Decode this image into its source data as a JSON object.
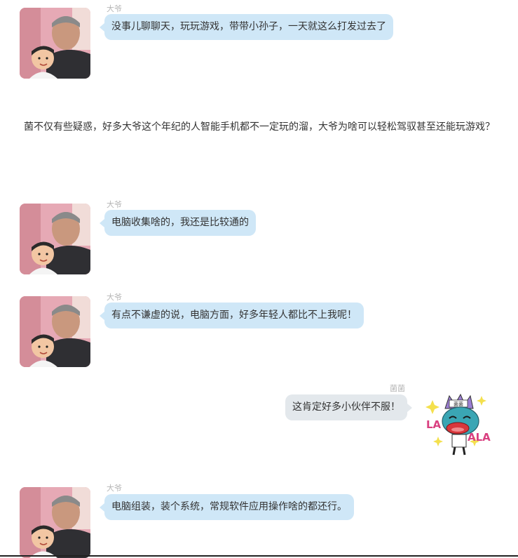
{
  "messages": [
    {
      "speaker": "大爷",
      "text": "没事儿聊聊天，玩玩游戏，带带小孙子，一天就这么打发过去了"
    },
    {
      "speaker": "大爷",
      "text": "电脑收集啥的，我还是比较通的"
    },
    {
      "speaker": "大爷",
      "text": "有点不谦虚的说，电脑方面，好多年轻人都比不上我呢！"
    },
    {
      "speaker": "菌菌",
      "text": "这肯定好多小伙伴不服！"
    },
    {
      "speaker": "大爷",
      "text": "电脑组装，装个系统，常规软件应用操作啥的都还行。"
    }
  ],
  "paragraph": "菌不仅有些疑惑，好多大爷这个年纪的人智能手机都不一定玩的溜，大爷为啥可以轻松驾驭甚至还能玩游戏？",
  "sticker": {
    "text_left": "LA",
    "text_right": "ALA",
    "hat_text": "菌菌",
    "icon": "laughing-monster-sticker"
  },
  "colors": {
    "left_bubble": "#cfe7f7",
    "right_bubble": "#e3e8ec",
    "name_text": "#b5b5b5"
  }
}
